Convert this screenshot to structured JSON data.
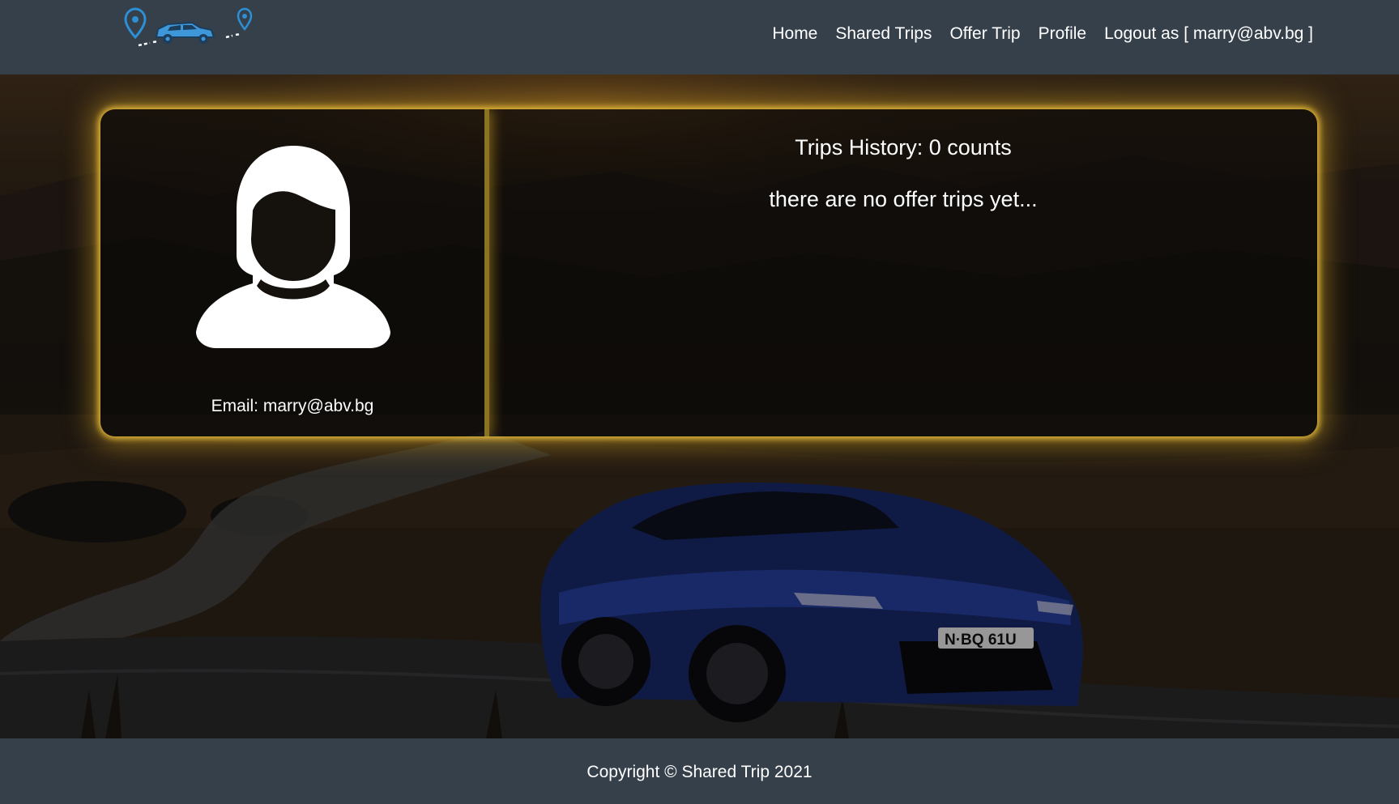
{
  "nav": {
    "logo_icon": "car-trip-route-logo",
    "links": [
      "Home",
      "Shared Trips",
      "Offer Trip",
      "Profile",
      "Logout as [ marry@abv.bg ]"
    ]
  },
  "profile": {
    "avatar_icon": "female-user-avatar",
    "email_text": "Email: marry@abv.bg",
    "history_title": "Trips History: 0 counts",
    "empty_message": "there are no offer trips yet..."
  },
  "footer": {
    "copyright": "Copyright © Shared Trip 2021"
  },
  "colors": {
    "bar_background": "#36404b",
    "card_glow": "#eabe3c",
    "logo_blue": "#2d8fd5"
  }
}
